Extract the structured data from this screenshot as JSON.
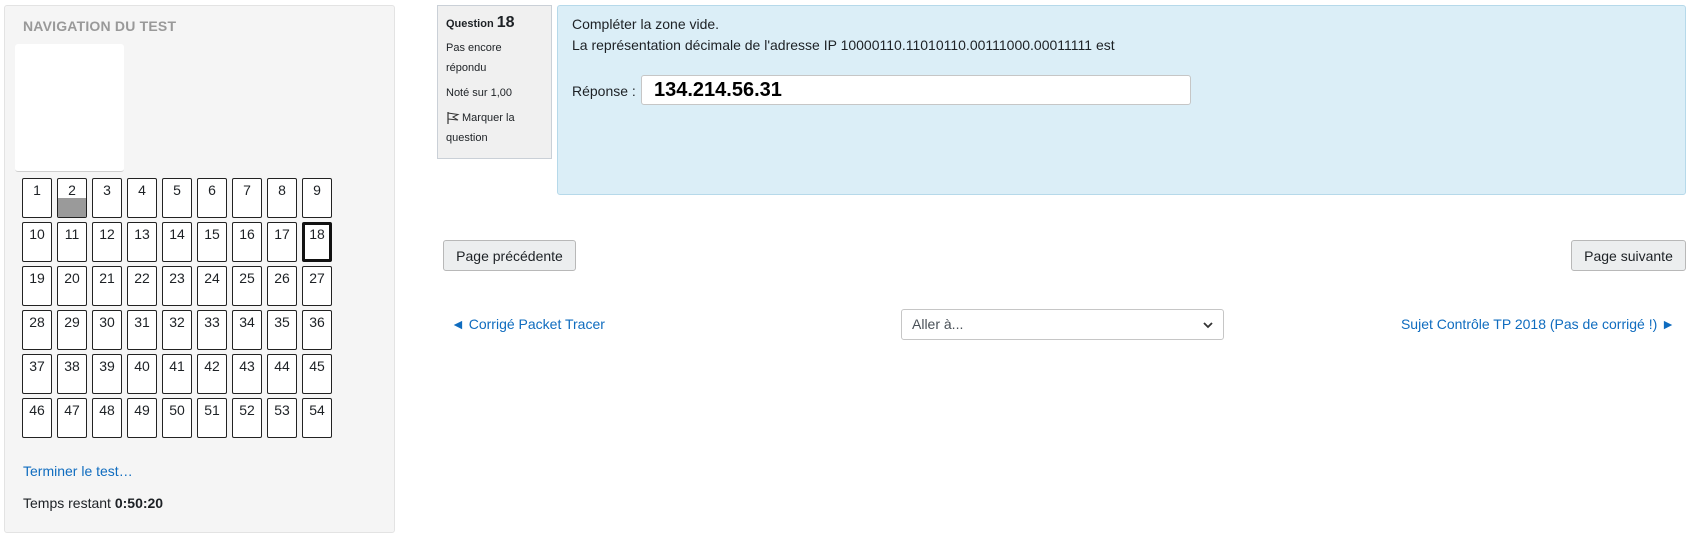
{
  "nav": {
    "title": "NAVIGATION DU TEST",
    "questions": [
      {
        "n": "1"
      },
      {
        "n": "2",
        "answered": true
      },
      {
        "n": "3"
      },
      {
        "n": "4"
      },
      {
        "n": "5"
      },
      {
        "n": "6"
      },
      {
        "n": "7"
      },
      {
        "n": "8"
      },
      {
        "n": "9"
      },
      {
        "n": "10"
      },
      {
        "n": "11"
      },
      {
        "n": "12"
      },
      {
        "n": "13"
      },
      {
        "n": "14"
      },
      {
        "n": "15"
      },
      {
        "n": "16"
      },
      {
        "n": "17"
      },
      {
        "n": "18",
        "current": true
      },
      {
        "n": "19"
      },
      {
        "n": "20"
      },
      {
        "n": "21"
      },
      {
        "n": "22"
      },
      {
        "n": "23"
      },
      {
        "n": "24"
      },
      {
        "n": "25"
      },
      {
        "n": "26"
      },
      {
        "n": "27"
      },
      {
        "n": "28"
      },
      {
        "n": "29"
      },
      {
        "n": "30"
      },
      {
        "n": "31"
      },
      {
        "n": "32"
      },
      {
        "n": "33"
      },
      {
        "n": "34"
      },
      {
        "n": "35"
      },
      {
        "n": "36"
      },
      {
        "n": "37"
      },
      {
        "n": "38"
      },
      {
        "n": "39"
      },
      {
        "n": "40"
      },
      {
        "n": "41"
      },
      {
        "n": "42"
      },
      {
        "n": "43"
      },
      {
        "n": "44"
      },
      {
        "n": "45"
      },
      {
        "n": "46"
      },
      {
        "n": "47"
      },
      {
        "n": "48"
      },
      {
        "n": "49"
      },
      {
        "n": "50"
      },
      {
        "n": "51"
      },
      {
        "n": "52"
      },
      {
        "n": "53"
      },
      {
        "n": "54"
      }
    ],
    "finish_link": "Terminer le test…",
    "time_label": "Temps restant",
    "time_value": "0:50:20"
  },
  "question": {
    "label": "Question",
    "number": "18",
    "state_line1": "Pas encore",
    "state_line2": "répondu",
    "grade": "Noté sur 1,00",
    "flag_line1": "Marquer la",
    "flag_line2": "question",
    "text1": "Compléter la zone vide.",
    "text2": "La représentation décimale de l'adresse IP 10000110.11010110.00111000.00011111 est",
    "answer_label": "Réponse :",
    "answer_value": "134.214.56.31"
  },
  "buttons": {
    "prev": "Page précédente",
    "next": "Page suivante"
  },
  "activity_nav": {
    "prev": "◄ Corrigé Packet Tracer",
    "jump": "Aller à...",
    "next": "Sujet Contrôle TP 2018 (Pas de corrigé !) ►"
  },
  "colors": {
    "link": "#0f6cbf",
    "question_bg": "#dbeef7",
    "answered_fill": "#9a9a9a"
  },
  "icons": {
    "flag": "flag-icon",
    "select_chevron": "chevron-down-icon"
  }
}
